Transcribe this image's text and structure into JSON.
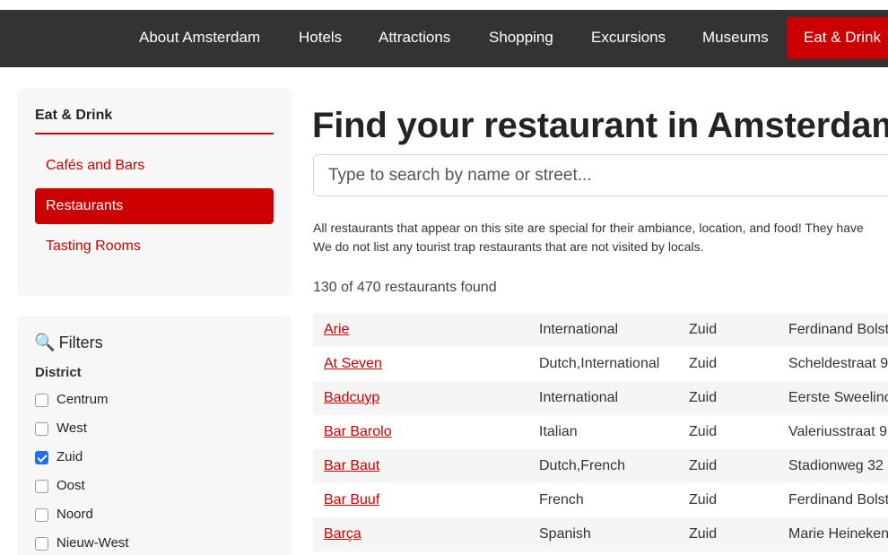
{
  "nav": {
    "items": [
      "About Amsterdam",
      "Hotels",
      "Attractions",
      "Shopping",
      "Excursions",
      "Museums",
      "Eat & Drink"
    ],
    "active_index": 6
  },
  "sidebar": {
    "title": "Eat & Drink",
    "links": [
      "Cafés and Bars",
      "Restaurants",
      "Tasting Rooms"
    ],
    "active_index": 1
  },
  "filters": {
    "title": "Filters",
    "icon": "magnifier-icon",
    "group_label": "District",
    "options": [
      {
        "label": "Centrum",
        "checked": false
      },
      {
        "label": "West",
        "checked": false
      },
      {
        "label": "Zuid",
        "checked": true
      },
      {
        "label": "Oost",
        "checked": false
      },
      {
        "label": "Noord",
        "checked": false
      },
      {
        "label": "Nieuw-West",
        "checked": false
      }
    ]
  },
  "main": {
    "title": "Find your restaurant in Amsterdam",
    "search_placeholder": "Type to search by name or street...",
    "intro_line1": "All restaurants that appear on this site are special for their ambiance, location, and food! They have",
    "intro_line2": "We do not list any tourist trap restaurants that are not visited by locals.",
    "count_text": "130 of 470 restaurants found"
  },
  "restaurants": [
    {
      "name": "Arie",
      "cuisine": "International",
      "district": "Zuid",
      "address": "Ferdinand Bolst"
    },
    {
      "name": "At Seven",
      "cuisine": "Dutch,International",
      "district": "Zuid",
      "address": "Scheldestraat 9"
    },
    {
      "name": "Badcuyp",
      "cuisine": "International",
      "district": "Zuid",
      "address": "Eerste Sweelinc"
    },
    {
      "name": "Bar Barolo",
      "cuisine": "Italian",
      "district": "Zuid",
      "address": "Valeriusstraat 9"
    },
    {
      "name": "Bar Baut",
      "cuisine": "Dutch,French",
      "district": "Zuid",
      "address": "Stadionweg 32"
    },
    {
      "name": "Bar Buuf",
      "cuisine": "French",
      "district": "Zuid",
      "address": "Ferdinand Bolst"
    },
    {
      "name": "Barça",
      "cuisine": "Spanish",
      "district": "Zuid",
      "address": "Marie Heineken"
    }
  ],
  "colors": {
    "brand_red": "#cc0000",
    "nav_bg": "#333333",
    "checkbox_blue": "#1a6ff2"
  }
}
